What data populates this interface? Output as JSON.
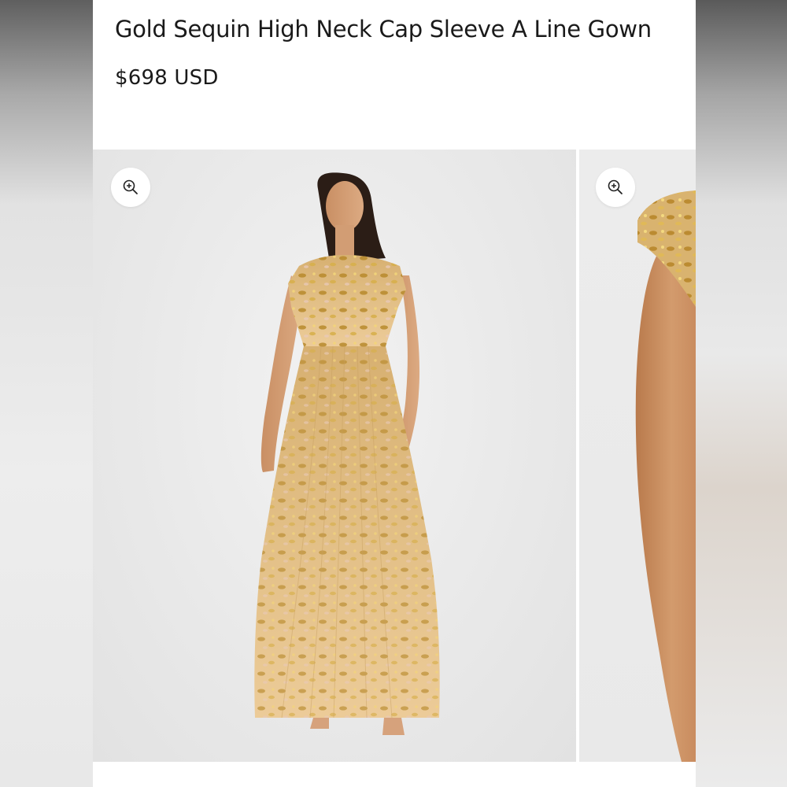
{
  "product": {
    "title": "Gold Sequin High Neck Cap Sleeve A Line Gown",
    "price": "$698 USD"
  },
  "gallery": {
    "slides": [
      {
        "zoom_icon": "zoom-in-icon",
        "image": "model in gold sequin gown, front view"
      },
      {
        "zoom_icon": "zoom-in-icon",
        "image": "close-up of cap sleeve and arm"
      }
    ]
  },
  "colors": {
    "text": "#1a1a1a",
    "background": "#ffffff",
    "gown_gold": "#d9b77c",
    "sequin": "#c9a146"
  }
}
